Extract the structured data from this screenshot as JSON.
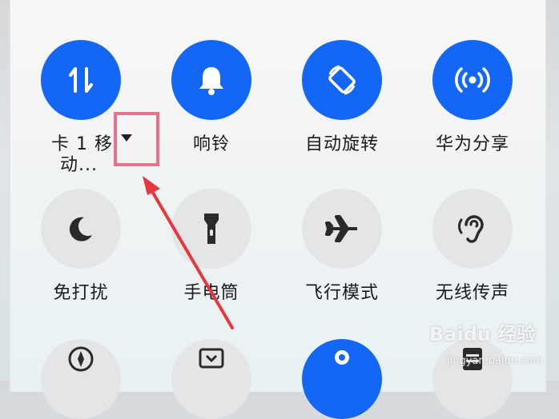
{
  "tiles": [
    {
      "label": "卡 1 移",
      "label_line2": "动...",
      "icon": "data-transfer-icon",
      "state": "on"
    },
    {
      "label": "响铃",
      "icon": "bell-icon",
      "state": "on"
    },
    {
      "label": "自动旋转",
      "icon": "rotate-icon",
      "state": "on"
    },
    {
      "label": "华为分享",
      "icon": "share-broadcast-icon",
      "state": "on"
    },
    {
      "label": "免打扰",
      "icon": "moon-icon",
      "state": "off"
    },
    {
      "label": "手电筒",
      "icon": "flashlight-icon",
      "state": "off"
    },
    {
      "label": "飞行模式",
      "icon": "airplane-icon",
      "state": "off"
    },
    {
      "label": "无线传声",
      "icon": "ear-icon",
      "state": "off"
    }
  ],
  "bottom_row_icons": [
    "compass-icon",
    "screencast-icon",
    "location-icon",
    "notes-icon"
  ],
  "annotation": {
    "box_color": "#ef6e8c",
    "arrow_color": "#e8363c"
  },
  "watermark": {
    "brand": "Baidu 经验",
    "url": "jingyan.baidu.com"
  },
  "colors": {
    "active": "#1466f5",
    "inactive": "#e4e5e6"
  }
}
